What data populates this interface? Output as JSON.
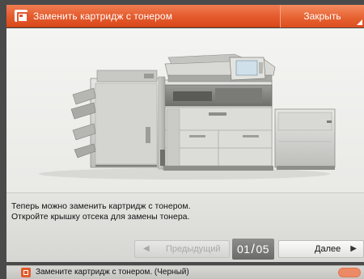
{
  "dialog": {
    "title": "Заменить картридж с тонером",
    "close_label": "Закрыть"
  },
  "message": {
    "line1": "Теперь можно заменить картридж с тонером.",
    "line2": "Откройте крышку отсека для замены тонера."
  },
  "navigation": {
    "prev_label": "Предыдущий",
    "next_label": "Далее",
    "page_current": "01",
    "page_total": "05"
  },
  "status": {
    "text": "Замените картридж с тонером. (Черный)"
  },
  "colors": {
    "accent": "#e45a2c",
    "panel": "#d6d6d3"
  }
}
